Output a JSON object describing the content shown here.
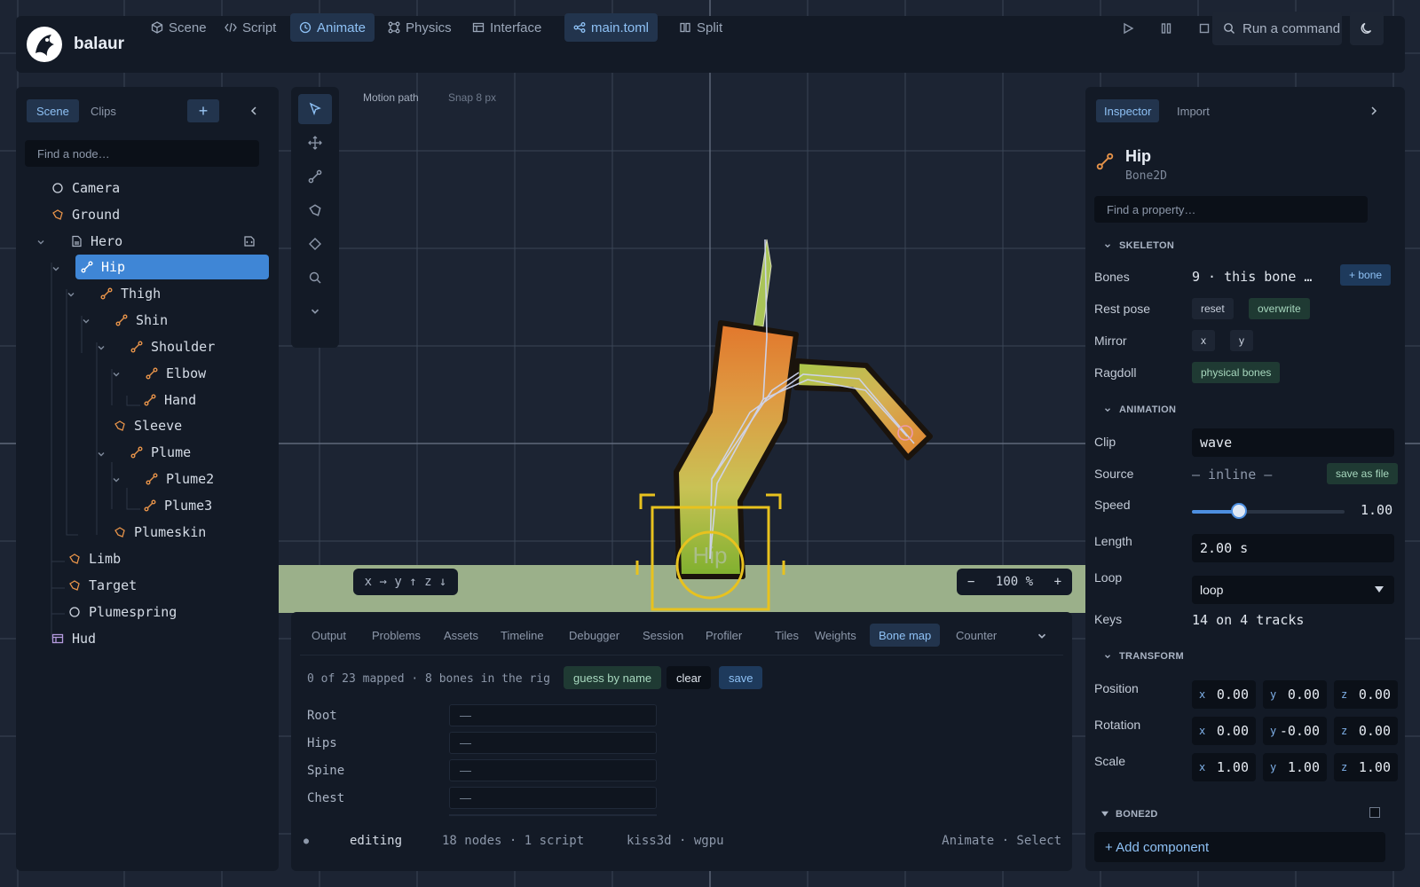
{
  "app": {
    "name": "balaur"
  },
  "topnav": [
    {
      "label": "Scene",
      "icon": "cube-icon"
    },
    {
      "label": "Script",
      "icon": "code-icon"
    },
    {
      "label": "Animate",
      "icon": "clock-icon"
    },
    {
      "label": "Physics",
      "icon": "physics-icon"
    },
    {
      "label": "Interface",
      "icon": "layout-icon"
    }
  ],
  "active_nav": "Animate",
  "file_tab": {
    "label": "main.toml",
    "icon": "graph-icon"
  },
  "split": {
    "label": "Split",
    "icon": "columns-icon"
  },
  "command": {
    "label": "Run a command"
  },
  "left_panel": {
    "tabs": [
      "Scene",
      "Clips"
    ],
    "active_tab": "Scene",
    "search_placeholder": "Find a node…",
    "tree": [
      {
        "label": "Camera",
        "icon": "circle-icon",
        "depth": 0
      },
      {
        "label": "Ground",
        "icon": "polygon-icon",
        "depth": 0
      },
      {
        "label": "Hero",
        "icon": "scene-icon",
        "depth": 0,
        "expanded": true
      },
      {
        "label": "Hip",
        "icon": "bone-icon",
        "depth": 1,
        "expanded": true,
        "selected": true
      },
      {
        "label": "Thigh",
        "icon": "bone-icon",
        "depth": 2,
        "expanded": true
      },
      {
        "label": "Shin",
        "icon": "bone-icon",
        "depth": 3,
        "expanded": true
      },
      {
        "label": "Shoulder",
        "icon": "bone-icon",
        "depth": 4,
        "expanded": true
      },
      {
        "label": "Elbow",
        "icon": "bone-icon",
        "depth": 5,
        "expanded": true
      },
      {
        "label": "Hand",
        "icon": "bone-icon",
        "depth": 6
      },
      {
        "label": "Sleeve",
        "icon": "polygon-icon",
        "depth": 4
      },
      {
        "label": "Plume",
        "icon": "bone-icon",
        "depth": 4,
        "expanded": true
      },
      {
        "label": "Plume2",
        "icon": "bone-icon",
        "depth": 5,
        "expanded": true
      },
      {
        "label": "Plume3",
        "icon": "bone-icon",
        "depth": 6
      },
      {
        "label": "Plumeskin",
        "icon": "polygon-icon",
        "depth": 4
      },
      {
        "label": "Limb",
        "icon": "polygon-icon",
        "depth": 1
      },
      {
        "label": "Target",
        "icon": "polygon-icon",
        "depth": 1
      },
      {
        "label": "Plumespring",
        "icon": "circle-icon",
        "depth": 1
      },
      {
        "label": "Hud",
        "icon": "layout-icon",
        "depth": 0
      }
    ]
  },
  "viewport": {
    "motion_path_label": "Motion path",
    "snap_label": "Snap 8 px",
    "bone_label": "Hip",
    "axes_label": "x → y ↑ z ↓",
    "zoom": {
      "minus": "−",
      "value": "100 %",
      "plus": "+"
    }
  },
  "bottom_panel": {
    "tabs": [
      "Output",
      "Problems",
      "Assets",
      "Timeline",
      "Debugger",
      "Session",
      "Profiler",
      "Tiles",
      "Weights",
      "Bone map",
      "Counter"
    ],
    "active_tab": "Bone map",
    "mapping_info": "0 of 23 mapped · 8 bones in the rig",
    "buttons": {
      "guess": "guess by name",
      "clear": "clear",
      "save": "save"
    },
    "rows": [
      {
        "label": "Root",
        "value": "—"
      },
      {
        "label": "Hips",
        "value": "—"
      },
      {
        "label": "Spine",
        "value": "—"
      },
      {
        "label": "Chest",
        "value": "—"
      }
    ],
    "status": {
      "dot": "●",
      "mode": "editing",
      "stats": "18 nodes · 1 script",
      "renderer": "kiss3d · wgpu",
      "right": "Animate · Select"
    }
  },
  "inspector": {
    "tabs": [
      "Inspector",
      "Import"
    ],
    "active_tab": "Inspector",
    "node_name": "Hip",
    "node_type": "Bone2D",
    "search_placeholder": "Find a property…",
    "skeleton": {
      "title": "SKELETON",
      "bones_label": "Bones",
      "bones_value": "9 · this bone …",
      "add_bone": "+ bone",
      "rest_pose_label": "Rest pose",
      "reset": "reset",
      "overwrite": "overwrite",
      "mirror_label": "Mirror",
      "mirror_x": "x",
      "mirror_y": "y",
      "ragdoll_label": "Ragdoll",
      "physical_bones": "physical bones"
    },
    "animation": {
      "title": "ANIMATION",
      "clip_label": "Clip",
      "clip_value": "wave",
      "source_label": "Source",
      "source_value": "— inline —",
      "save_as_file": "save as file",
      "speed_label": "Speed",
      "speed_value": "1.00",
      "speed_fraction": 0.31,
      "length_label": "Length",
      "length_value": "2.00 s",
      "loop_label": "Loop",
      "loop_value": "loop",
      "keys_label": "Keys",
      "keys_value": "14 on 4 tracks"
    },
    "transform": {
      "title": "TRANSFORM",
      "position_label": "Position",
      "position": [
        "0.00",
        "0.00",
        "0.00"
      ],
      "rotation_label": "Rotation",
      "rotation": [
        "0.00",
        "-0.00",
        "0.00"
      ],
      "scale_label": "Scale",
      "scale": [
        "1.00",
        "1.00",
        "1.00"
      ],
      "axes": [
        "x",
        "y",
        "z"
      ]
    },
    "bone2d": {
      "title": "BONE2D"
    },
    "add_component": "+ Add component"
  },
  "colors": {
    "background": "#1c2433",
    "panel": "#131a26",
    "accent": "#3f86d6",
    "bone_icon": "#e8944a",
    "selection_gizmo": "#e8c21e"
  }
}
